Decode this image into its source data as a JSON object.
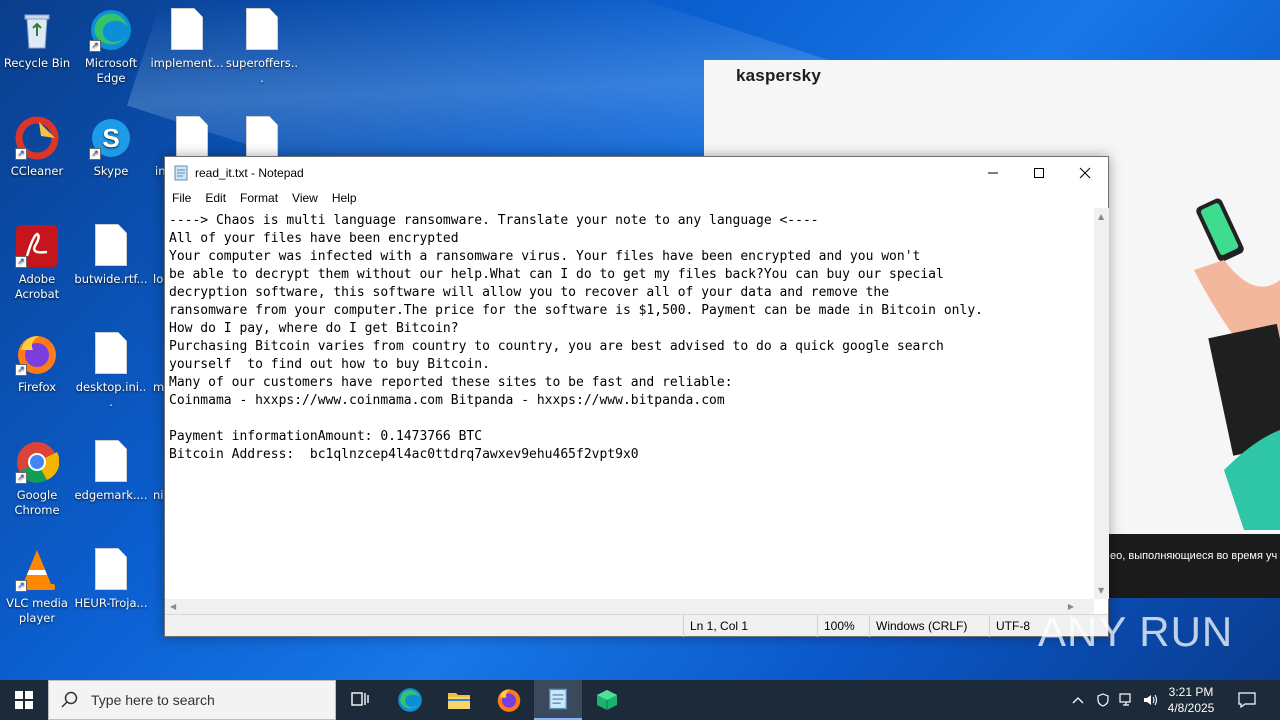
{
  "desktop": {
    "icons": [
      {
        "label": "Recycle Bin"
      },
      {
        "label": "Microsoft Edge"
      },
      {
        "label": "implement..."
      },
      {
        "label": "superoffers..."
      },
      {
        "label": "CCleaner"
      },
      {
        "label": "Skype"
      },
      {
        "label": "in"
      },
      {
        "label": "Adobe Acrobat"
      },
      {
        "label": "butwide.rtf..."
      },
      {
        "label": "lo"
      },
      {
        "label": "Firefox"
      },
      {
        "label": "desktop.ini..."
      },
      {
        "label": "m"
      },
      {
        "label": "Google Chrome"
      },
      {
        "label": "edgemark...."
      },
      {
        "label": "ni"
      },
      {
        "label": "VLC media player"
      },
      {
        "label": "HEUR-Troja..."
      }
    ]
  },
  "kaspersky": {
    "logo": "kaspersky",
    "strip_text": "ео, выполняющиеся во время уч"
  },
  "notepad": {
    "title": "read_it.txt - Notepad",
    "menu": [
      "File",
      "Edit",
      "Format",
      "View",
      "Help"
    ],
    "content": "----> Chaos is multi language ransomware. Translate your note to any language <----\nAll of your files have been encrypted\nYour computer was infected with a ransomware virus. Your files have been encrypted and you won't\nbe able to decrypt them without our help.What can I do to get my files back?You can buy our special\ndecryption software, this software will allow you to recover all of your data and remove the\nransomware from your computer.The price for the software is $1,500. Payment can be made in Bitcoin only.\nHow do I pay, where do I get Bitcoin?\nPurchasing Bitcoin varies from country to country, you are best advised to do a quick google search\nyourself  to find out how to buy Bitcoin.\nMany of our customers have reported these sites to be fast and reliable:\nCoinmama - hxxps://www.coinmama.com Bitpanda - hxxps://www.bitpanda.com\n\nPayment informationAmount: 0.1473766 BTC\nBitcoin Address:  bc1qlnzcep4l4ac0ttdrq7awxev9ehu465f2vpt9x0",
    "status": {
      "position": "Ln 1, Col 1",
      "zoom": "100%",
      "line_ending": "Windows (CRLF)",
      "encoding": "UTF-8"
    }
  },
  "watermark": "ANY RUN",
  "taskbar": {
    "search_placeholder": "Type here to search",
    "clock_time": "3:21 PM",
    "clock_date": "4/8/2025"
  }
}
